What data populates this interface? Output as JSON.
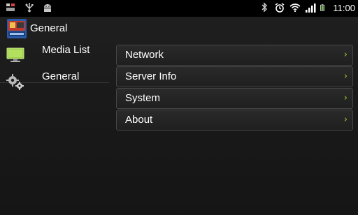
{
  "status_bar": {
    "time": "11:00",
    "icons_left": [
      "notification-icon",
      "usb-icon",
      "android-debug-icon"
    ],
    "icons_right": [
      "bluetooth-icon",
      "alarm-icon",
      "wifi-icon",
      "signal-icon",
      "battery-icon"
    ]
  },
  "action_bar": {
    "title": "General",
    "app_icon": "app-logo-icon"
  },
  "headers": {
    "items": [
      {
        "label": "Media List",
        "icon": "monitor-icon"
      },
      {
        "label": "General",
        "icon": "gears-icon"
      }
    ]
  },
  "preferences": {
    "items": [
      {
        "label": "Network"
      },
      {
        "label": "Server Info"
      },
      {
        "label": "System"
      },
      {
        "label": "About"
      }
    ],
    "chevron": "›"
  },
  "colors": {
    "chevron": "#9acd32",
    "item_border": "#464646",
    "background": "#1a1a1a"
  }
}
